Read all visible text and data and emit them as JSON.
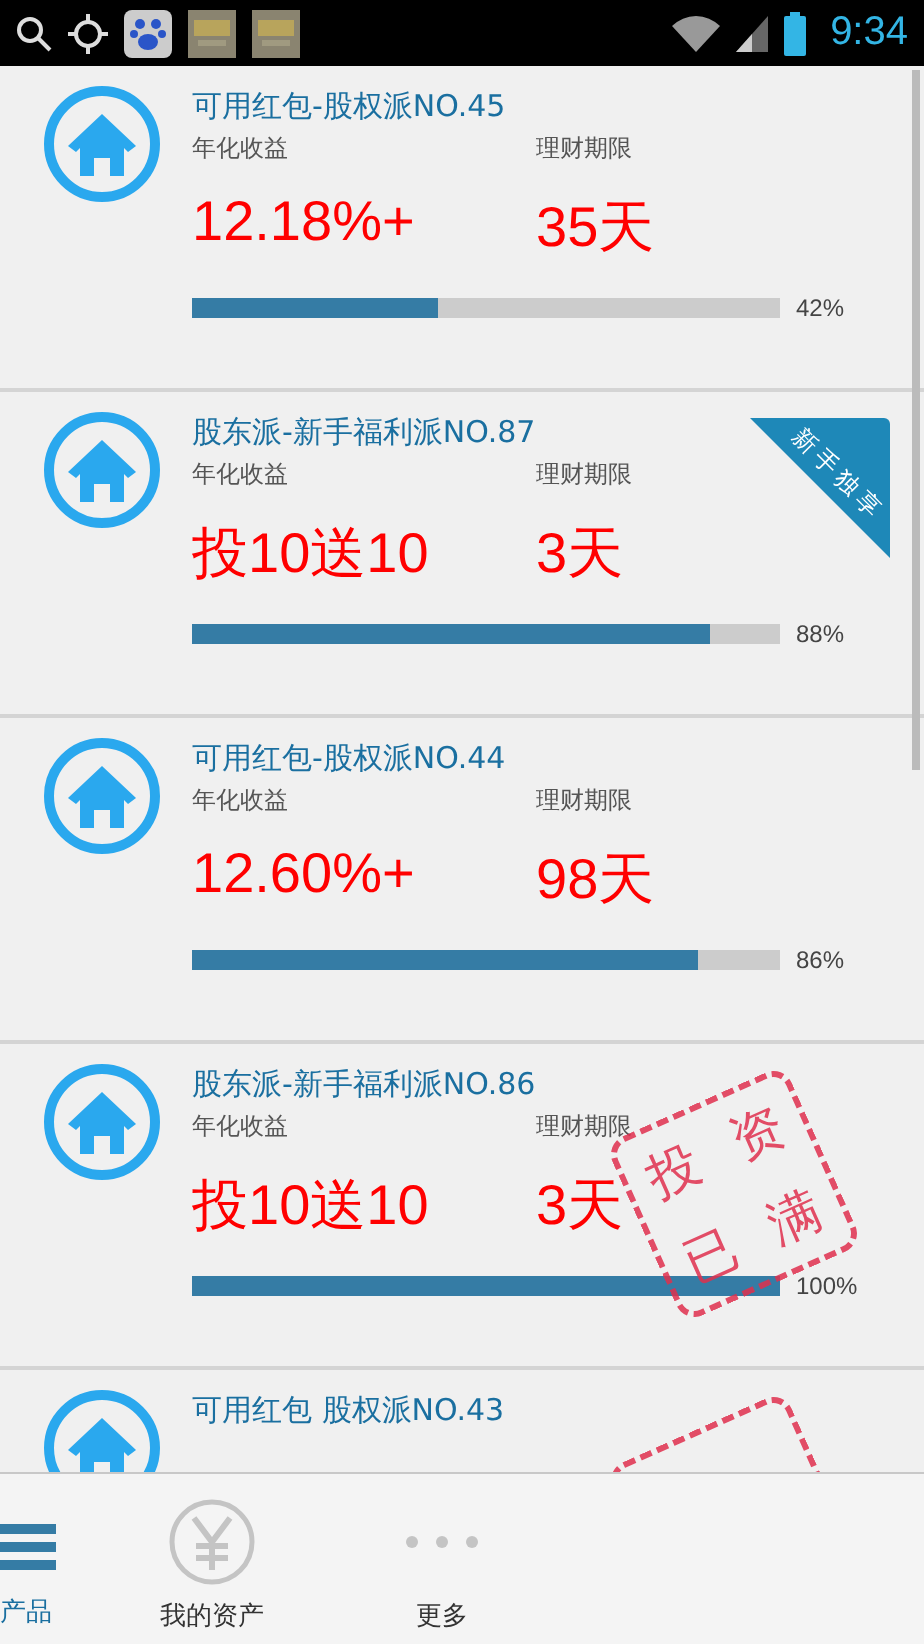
{
  "status_bar": {
    "time": "9:34"
  },
  "products": [
    {
      "title": "可用红包-股权派NO.45",
      "rate_label": "年化收益",
      "term_label": "理财期限",
      "rate": "12.18%+",
      "term": "35天",
      "level": 0.42,
      "percent": "42%",
      "sold_out": false
    },
    {
      "title": "股东派-新手福利派NO.87",
      "rate_label": "年化收益",
      "term_label": "理财期限",
      "rate": "投10送10",
      "term": "3天",
      "level": 0.88,
      "percent": "88%",
      "sold_out": false,
      "badge": "新手独享"
    },
    {
      "title": "可用红包-股权派NO.44",
      "rate_label": "年化收益",
      "term_label": "理财期限",
      "rate": "12.60%+",
      "term": "98天",
      "level": 0.86,
      "percent": "86%",
      "sold_out": false
    },
    {
      "title": "股东派-新手福利派NO.86",
      "rate_label": "年化收益",
      "term_label": "理财期限",
      "rate": "投10送10",
      "term": "3天",
      "level": 1,
      "percent": "100%",
      "sold_out": true,
      "stamp": "投资已满"
    },
    {
      "title": "可用红包 股权派NO.43",
      "sold_out": true
    }
  ],
  "bottom_nav": [
    {
      "label": "产品",
      "kind": "list",
      "selected": true
    },
    {
      "label": "我的资产",
      "kind": "yen",
      "selected": false
    },
    {
      "label": "更多",
      "kind": "more",
      "selected": false
    }
  ]
}
